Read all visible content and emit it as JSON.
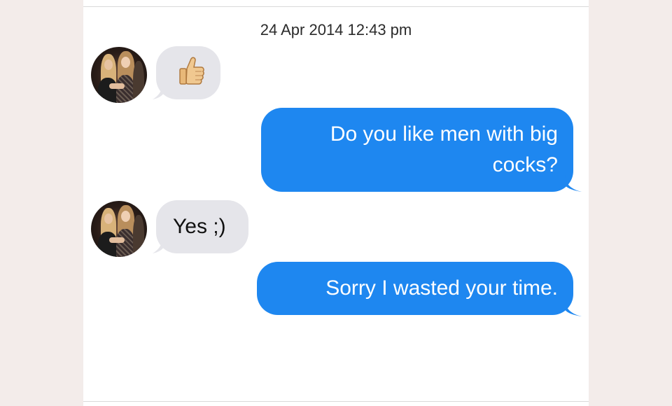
{
  "conversation": {
    "timestamp": "24 Apr 2014 12:43 pm",
    "messages": [
      {
        "sender": "them",
        "type": "emoji",
        "emoji": "thumbs-up-icon"
      },
      {
        "sender": "me",
        "line1": "Do you like men with big",
        "line2": "cocks?"
      },
      {
        "sender": "them",
        "text": "Yes ;)"
      },
      {
        "sender": "me",
        "text": "Sorry I wasted your time."
      }
    ]
  },
  "colors": {
    "outgoing_bubble": "#1e87f0",
    "incoming_bubble": "#e5e5ea",
    "page_background": "#f3ecea"
  }
}
